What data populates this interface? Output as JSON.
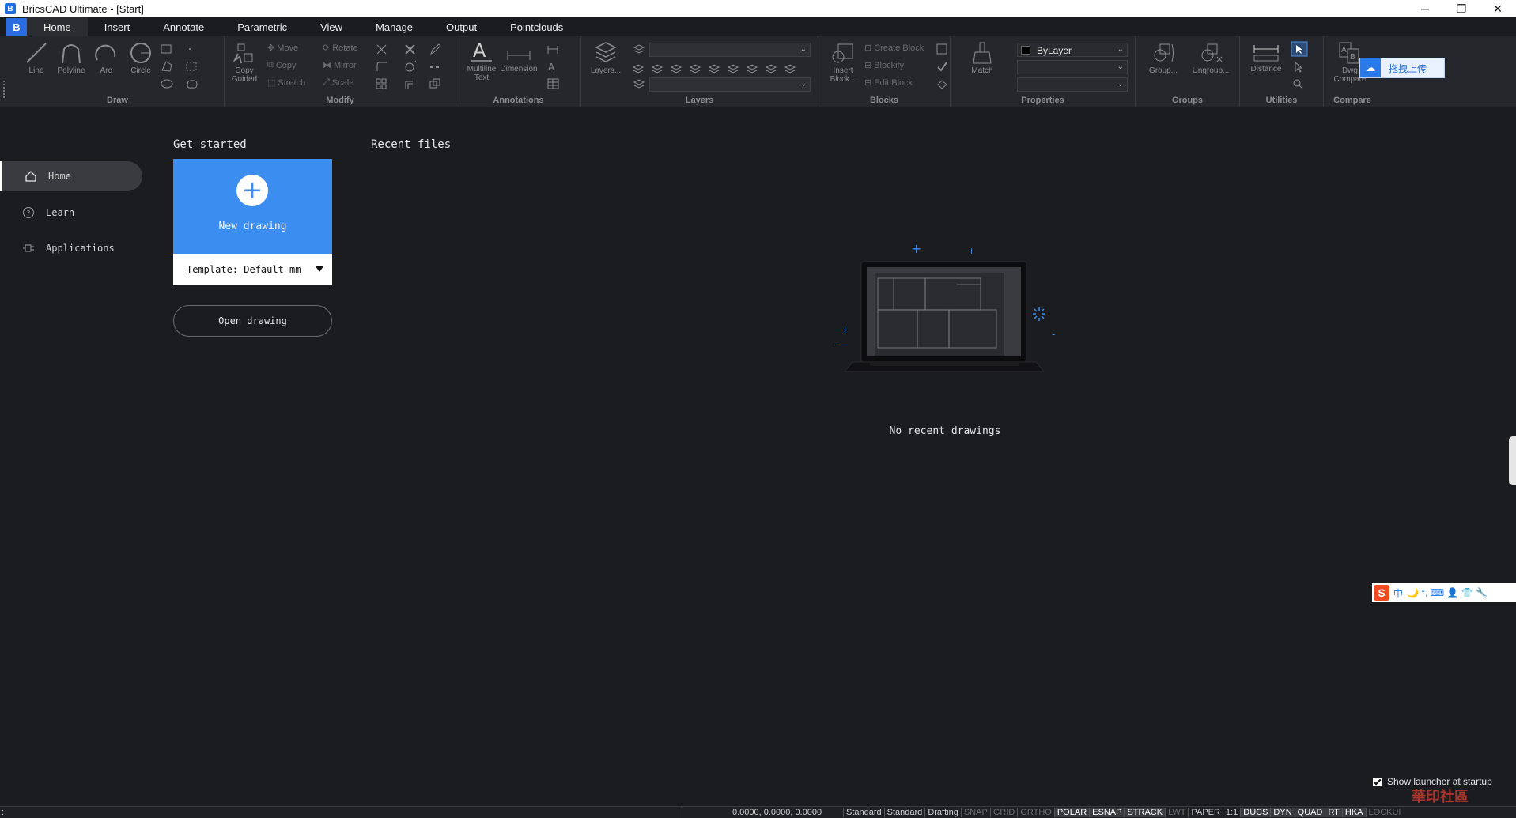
{
  "window": {
    "title": "BricsCAD Ultimate - [Start]",
    "buttons": {
      "minimize": "─",
      "restore": "❐",
      "close": "✕"
    }
  },
  "menu": {
    "logo": "B",
    "tabs": [
      "Home",
      "Insert",
      "Annotate",
      "Parametric",
      "View",
      "Manage",
      "Output",
      "Pointclouds"
    ],
    "active": "Home"
  },
  "ribbon": {
    "draw": {
      "label": "Draw",
      "tools": [
        "Line",
        "Polyline",
        "Arc",
        "Circle"
      ]
    },
    "modify": {
      "label": "Modify",
      "copy_guided": "Copy Guided",
      "move": "Move",
      "copy": "Copy",
      "stretch": "Stretch",
      "rotate": "Rotate",
      "mirror": "Mirror",
      "scale": "Scale"
    },
    "annotations": {
      "label": "Annotations",
      "multiline_text": "Multiline Text",
      "dimension": "Dimension"
    },
    "layers": {
      "label": "Layers",
      "layers_button": "Layers..."
    },
    "blocks": {
      "label": "Blocks",
      "insert_block": "Insert Block...",
      "create_block": "Create Block",
      "blockify": "Blockify",
      "edit_block": "Edit Block"
    },
    "properties": {
      "label": "Properties",
      "match": "Match",
      "bylayer": "ByLayer"
    },
    "groups": {
      "label": "Groups",
      "group": "Group...",
      "ungroup": "Ungroup..."
    },
    "utilities": {
      "label": "Utilities",
      "distance": "Distance"
    },
    "compare": {
      "label": "Compare",
      "dwg_compare": "Dwg Compare"
    },
    "upload": "拖拽上传"
  },
  "nav": {
    "items": [
      "Home",
      "Learn",
      "Applications"
    ],
    "active": "Home"
  },
  "start": {
    "get_started": "Get started",
    "recent_files": "Recent files",
    "new_drawing": "New drawing",
    "template": "Template: Default-mm",
    "open_drawing": "Open drawing",
    "no_recent": "No recent drawings",
    "show_launcher": "Show launcher at startup",
    "show_launcher_checked": true
  },
  "ime": {
    "logo": "S",
    "text": "中",
    "symbols": "🌙 °, ⌨ 👤 👕 🔧"
  },
  "status": {
    "command": ":",
    "coords": "0.0000, 0.0000, 0.0000",
    "items": [
      {
        "text": "Standard",
        "state": "plain"
      },
      {
        "text": "Standard",
        "state": "plain"
      },
      {
        "text": "Drafting",
        "state": "plain"
      },
      {
        "text": "SNAP",
        "state": "off"
      },
      {
        "text": "GRID",
        "state": "off"
      },
      {
        "text": "ORTHO",
        "state": "off"
      },
      {
        "text": "POLAR",
        "state": "on"
      },
      {
        "text": "ESNAP",
        "state": "on"
      },
      {
        "text": "STRACK",
        "state": "on"
      },
      {
        "text": "LWT",
        "state": "off"
      },
      {
        "text": "PAPER",
        "state": "plain"
      },
      {
        "text": "1:1",
        "state": "plain"
      },
      {
        "text": "DUCS",
        "state": "on"
      },
      {
        "text": "DYN",
        "state": "on"
      },
      {
        "text": "QUAD",
        "state": "on"
      },
      {
        "text": "RT",
        "state": "on"
      },
      {
        "text": "HKA",
        "state": "on"
      },
      {
        "text": "LOCKUI",
        "state": "off"
      }
    ]
  },
  "watermark": "華印社區",
  "colors": {
    "accent": "#3b8ef0",
    "background": "#1b1c20",
    "ribbon": "#26272c"
  }
}
